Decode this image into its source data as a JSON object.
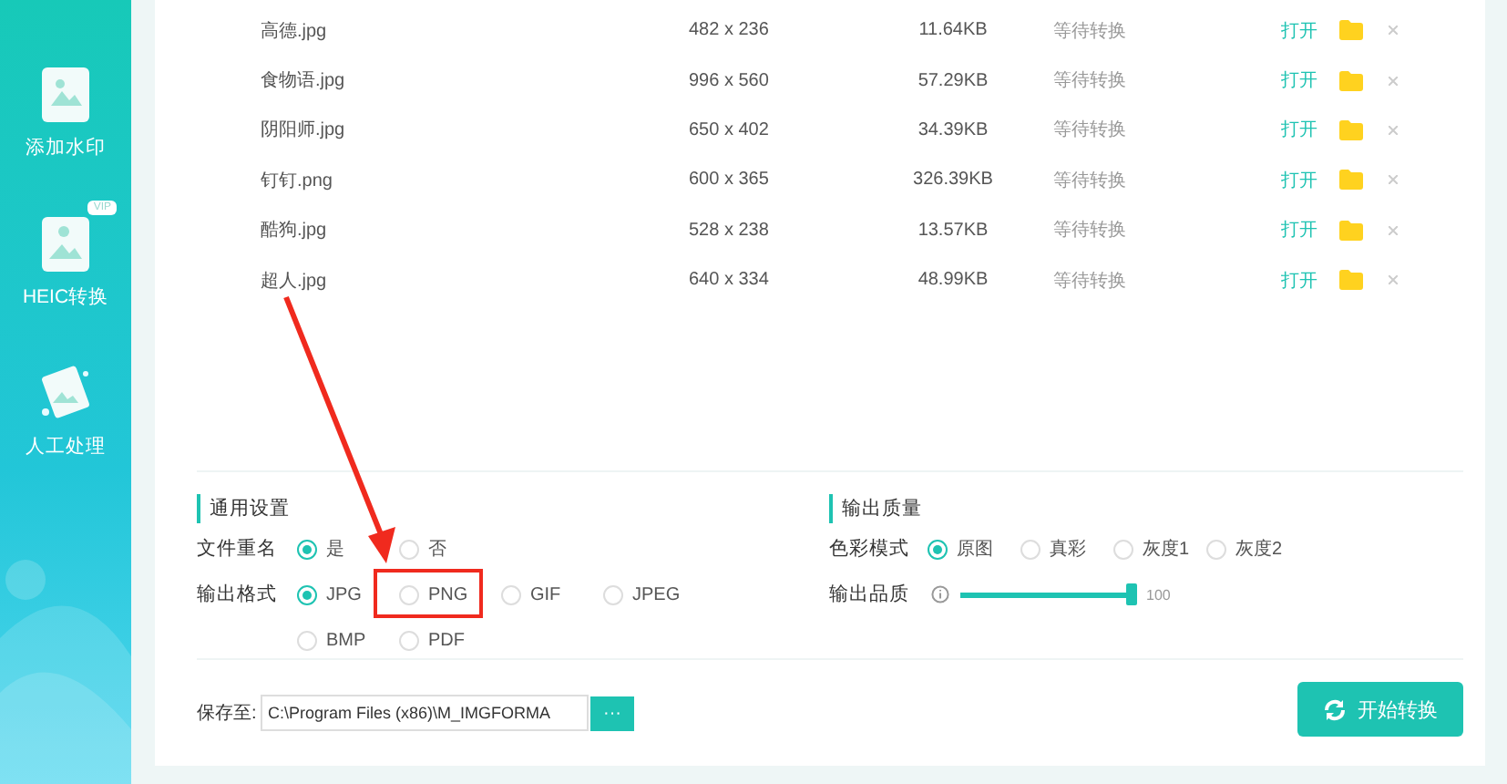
{
  "sidebar": {
    "items": [
      {
        "label": "添加水印"
      },
      {
        "label": "HEIC转换",
        "badge": "VIP"
      },
      {
        "label": "人工处理"
      }
    ]
  },
  "files": [
    {
      "name": "高德.jpg",
      "dimensions": "482 x 236",
      "size": "11.64KB",
      "status": "等待转换",
      "open": "打开"
    },
    {
      "name": "食物语.jpg",
      "dimensions": "996 x 560",
      "size": "57.29KB",
      "status": "等待转换",
      "open": "打开"
    },
    {
      "name": "阴阳师.jpg",
      "dimensions": "650 x 402",
      "size": "34.39KB",
      "status": "等待转换",
      "open": "打开"
    },
    {
      "name": "钉钉.png",
      "dimensions": "600 x 365",
      "size": "326.39KB",
      "status": "等待转换",
      "open": "打开"
    },
    {
      "name": "酷狗.jpg",
      "dimensions": "528 x 238",
      "size": "13.57KB",
      "status": "等待转换",
      "open": "打开"
    },
    {
      "name": "超人.jpg",
      "dimensions": "640 x 334",
      "size": "48.99KB",
      "status": "等待转换",
      "open": "打开"
    }
  ],
  "general_settings": {
    "title": "通用设置",
    "rows": [
      {
        "label": "文件重名",
        "options": [
          {
            "label": "是",
            "selected": true
          },
          {
            "label": "否",
            "selected": false
          }
        ]
      },
      {
        "label": "输出格式",
        "options": [
          {
            "label": "JPG",
            "selected": true
          },
          {
            "label": "PNG",
            "selected": false
          },
          {
            "label": "GIF",
            "selected": false
          },
          {
            "label": "JPEG",
            "selected": false
          },
          {
            "label": "BMP",
            "selected": false
          },
          {
            "label": "PDF",
            "selected": false
          }
        ]
      }
    ]
  },
  "output_quality": {
    "title": "输出质量",
    "color_mode": {
      "label": "色彩模式",
      "options": [
        {
          "label": "原图",
          "selected": true
        },
        {
          "label": "真彩",
          "selected": false
        },
        {
          "label": "灰度1",
          "selected": false
        },
        {
          "label": "灰度2",
          "selected": false
        }
      ]
    },
    "quality": {
      "label": "输出品质",
      "level": 1,
      "reading": "100"
    }
  },
  "save": {
    "label": "保存至:",
    "path": "C:\\Program Files (x86)\\M_IMGFORMA",
    "browse": "···"
  },
  "start_button": "开始转换"
}
